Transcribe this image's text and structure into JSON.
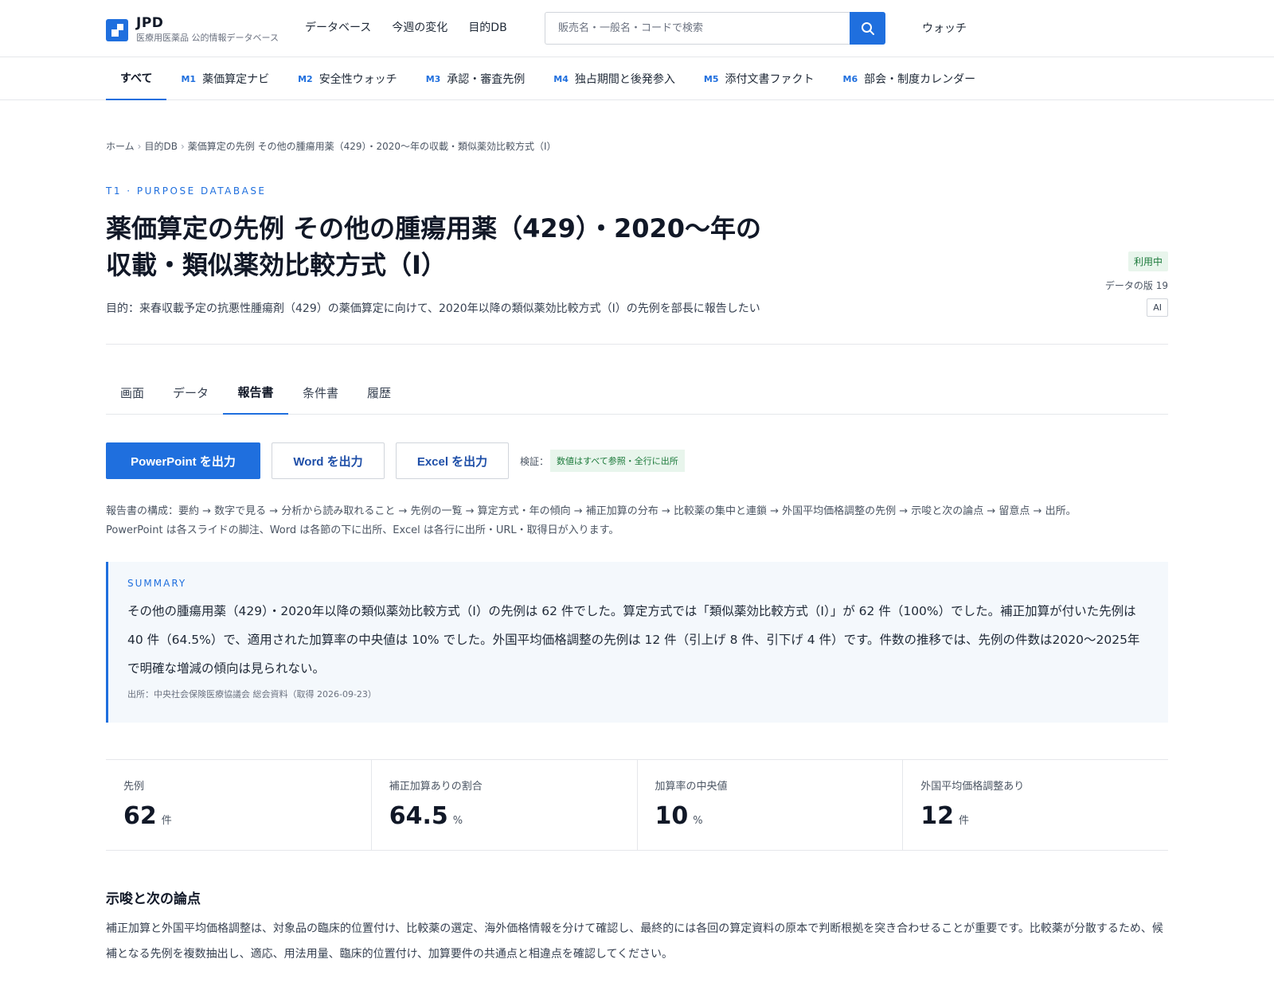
{
  "brand": {
    "name": "JPD",
    "subtitle": "医療用医薬品 公的情報データベース"
  },
  "topnav": {
    "items": [
      "データベース",
      "今週の変化",
      "目的DB"
    ]
  },
  "search": {
    "placeholder": "販売名・一般名・コードで検索"
  },
  "header": {
    "watch_label": "ウォッチ"
  },
  "modules": [
    {
      "code": "",
      "label": "すべて",
      "active": true
    },
    {
      "code": "M1",
      "label": "薬価算定ナビ"
    },
    {
      "code": "M2",
      "label": "安全性ウォッチ"
    },
    {
      "code": "M3",
      "label": "承認・審査先例"
    },
    {
      "code": "M4",
      "label": "独占期間と後発参入"
    },
    {
      "code": "M5",
      "label": "添付文書ファクト"
    },
    {
      "code": "M6",
      "label": "部会・制度カレンダー"
    }
  ],
  "breadcrumb": {
    "items": [
      "ホーム",
      "目的DB",
      "薬価算定の先例 その他の腫瘍用薬（429）・2020〜年の収載・類似薬効比較方式（I）"
    ],
    "separator": "›"
  },
  "page": {
    "eyebrow": "T1 · PURPOSE DATABASE",
    "title": "薬価算定の先例 その他の腫瘍用薬（429）・2020〜年の収載・類似薬効比較方式（I）",
    "purpose": "目的：来春収載予定の抗悪性腫瘍剤（429）の薬価算定に向けて、2020年以降の類似薬効比較方式（I）の先例を部長に報告したい",
    "status": "利用中",
    "data_version": "データの版 19",
    "ai_badge": "AI"
  },
  "tabs": [
    {
      "label": "画面"
    },
    {
      "label": "データ"
    },
    {
      "label": "報告書",
      "active": true
    },
    {
      "label": "条件書"
    },
    {
      "label": "履歴"
    }
  ],
  "actions": {
    "powerpoint": "PowerPoint を出力",
    "word": "Word を出力",
    "excel": "Excel を出力",
    "verify_label": "検証：",
    "verify_badge": "数値はすべて参照・全行に出所"
  },
  "structure": {
    "line1": "報告書の構成：要約 → 数字で見る → 分析から読み取れること → 先例の一覧 → 算定方式・年の傾向 → 補正加算の分布 → 比較薬の集中と連鎖 → 外国平均価格調整の先例 → 示唆と次の論点 → 留意点 → 出所。",
    "line2": "PowerPoint は各スライドの脚注、Word は各節の下に出所、Excel は各行に出所・URL・取得日が入ります。"
  },
  "summary": {
    "label": "SUMMARY",
    "text": "その他の腫瘍用薬（429）・2020年以降の類似薬効比較方式（I）の先例は 62 件でした。算定方式では「類似薬効比較方式（I）」が 62 件（100%）でした。補正加算が付いた先例は 40 件（64.5%）で、適用された加算率の中央値は 10% でした。外国平均価格調整の先例は 12 件（引上げ 8 件、引下げ 4 件）です。件数の推移では、先例の件数は2020〜2025年で明確な増減の傾向は見られない。",
    "source": "出所：中央社会保険医療協議会 総会資料（取得 2026-09-23）"
  },
  "stats": [
    {
      "label": "先例",
      "value": "62",
      "unit": "件"
    },
    {
      "label": "補正加算ありの割合",
      "value": "64.5",
      "unit": "%"
    },
    {
      "label": "加算率の中央値",
      "value": "10",
      "unit": "%"
    },
    {
      "label": "外国平均価格調整あり",
      "value": "12",
      "unit": "件"
    }
  ],
  "implications": {
    "heading": "示唆と次の論点",
    "body": "補正加算と外国平均価格調整は、対象品の臨床的位置付け、比較薬の選定、海外価格情報を分けて確認し、最終的には各回の算定資料の原本で判断根拠を突き合わせることが重要です。比較薬が分散するため、候補となる先例を複数抽出し、適応、用法用量、臨床的位置付け、加算要件の共通点と相違点を確認してください。"
  }
}
